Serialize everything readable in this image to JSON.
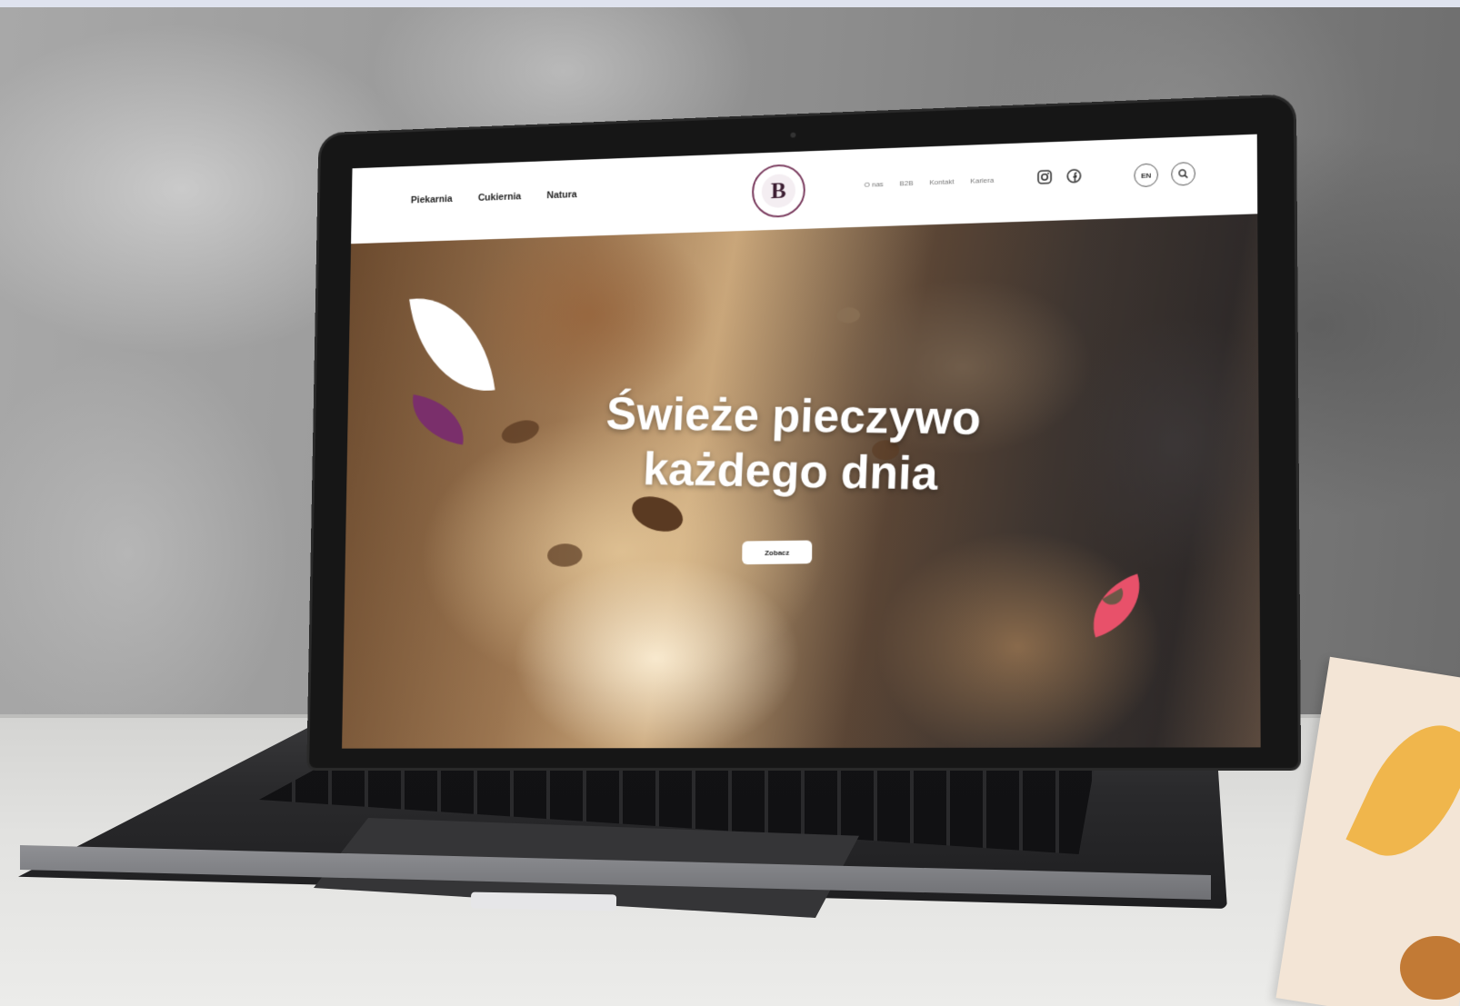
{
  "website": {
    "nav_left": [
      "Piekarnia",
      "Cukiernia",
      "Natura"
    ],
    "nav_right": [
      "O nas",
      "B2B",
      "Kontakt",
      "Kariera"
    ],
    "language": "EN",
    "hero": {
      "title_line1": "Świeże pieczywo",
      "title_line2": "każdego dnia",
      "button_label": "Zobacz"
    }
  },
  "icons": {
    "social": [
      "instagram-icon",
      "facebook-icon"
    ],
    "search": "search-icon",
    "logo": "bakery-logo"
  },
  "colors": {
    "accent_purple": "#7a2f6b",
    "accent_pink": "#e8516a",
    "logo_ring": "#7a3b5e"
  }
}
